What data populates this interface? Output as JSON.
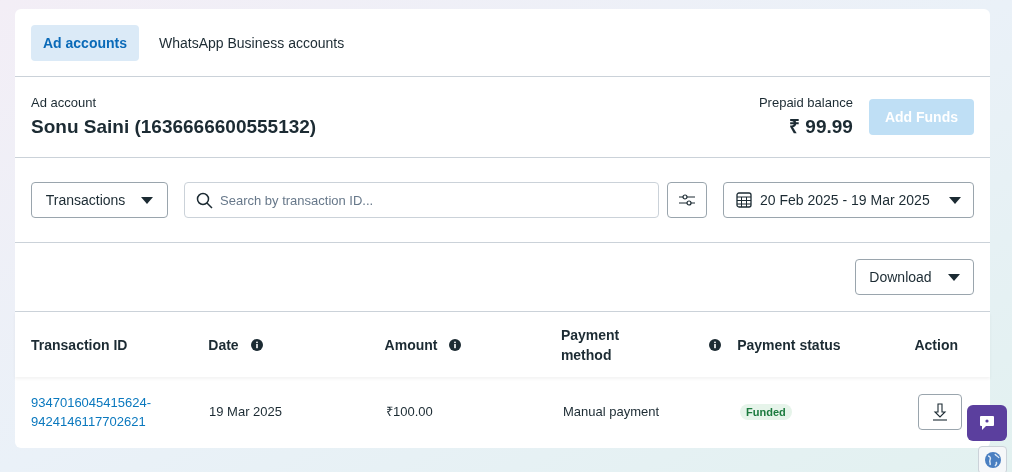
{
  "tabs": [
    {
      "label": "Ad accounts",
      "selected": true
    },
    {
      "label": "WhatsApp Business accounts",
      "selected": false
    }
  ],
  "account": {
    "label": "Ad account",
    "name": "Sonu Saini (1636666600555132)",
    "balance_label": "Prepaid balance",
    "balance": "₹ 99.99",
    "add_funds": {
      "label": "Add Funds",
      "disabled": true
    }
  },
  "filters": {
    "type_dropdown": "Transactions",
    "search": {
      "placeholder": "Search by transaction ID..."
    },
    "date_range": "20 Feb 2025 - 19 Mar 2025"
  },
  "download_button": "Download",
  "table": {
    "columns": [
      {
        "label": "Transaction ID",
        "info": false
      },
      {
        "label": "Date",
        "info": true
      },
      {
        "label": "Amount",
        "info": true
      },
      {
        "label": "Payment method",
        "info": true
      },
      {
        "label": "Payment status",
        "info": false
      },
      {
        "label": "Action",
        "info": false
      }
    ],
    "rows": [
      {
        "transaction_id": [
          "9347016045415624-",
          "9424146117702621"
        ],
        "date": "19 Mar 2025",
        "amount": "₹100.00",
        "payment_method": "Manual payment",
        "status": "Funded"
      }
    ]
  }
}
